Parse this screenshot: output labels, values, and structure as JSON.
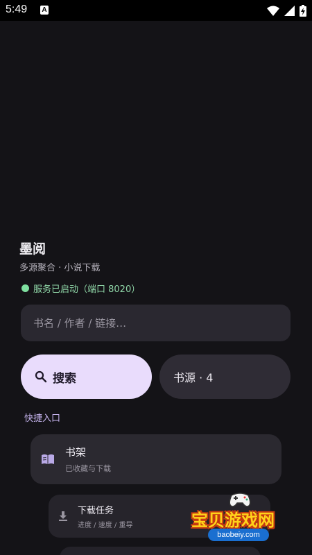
{
  "status_bar": {
    "time": "5:49",
    "notification_glyph": "A",
    "icons": [
      "wifi-icon",
      "cellular-signal-icon",
      "battery-charging-icon"
    ]
  },
  "app": {
    "title": "墨阅",
    "subtitle": "多源聚合 · 小说下载",
    "service_status": "服务已启动（端口 8020）",
    "status_color": "#7fe0a0"
  },
  "search": {
    "placeholder": "书名 / 作者 / 链接…",
    "button_label": "搜索",
    "button_icon": "search-icon"
  },
  "sources": {
    "label": "书源 · 4"
  },
  "quick_access": {
    "label": "快捷入口",
    "items": [
      {
        "title": "书架",
        "subtitle": "已收藏与下载",
        "icon": "book-open-icon"
      },
      {
        "title": "下载任务",
        "subtitle": "进度 / 速度 / 重导",
        "icon": "download-icon"
      }
    ]
  },
  "watermark": {
    "text": "宝贝游戏网",
    "url": "baobeiy.com"
  },
  "colors": {
    "background": "#141317",
    "accent": "#e9dcfc",
    "section_label": "#c8b6f0",
    "watermark_text": "#ffd21a"
  }
}
